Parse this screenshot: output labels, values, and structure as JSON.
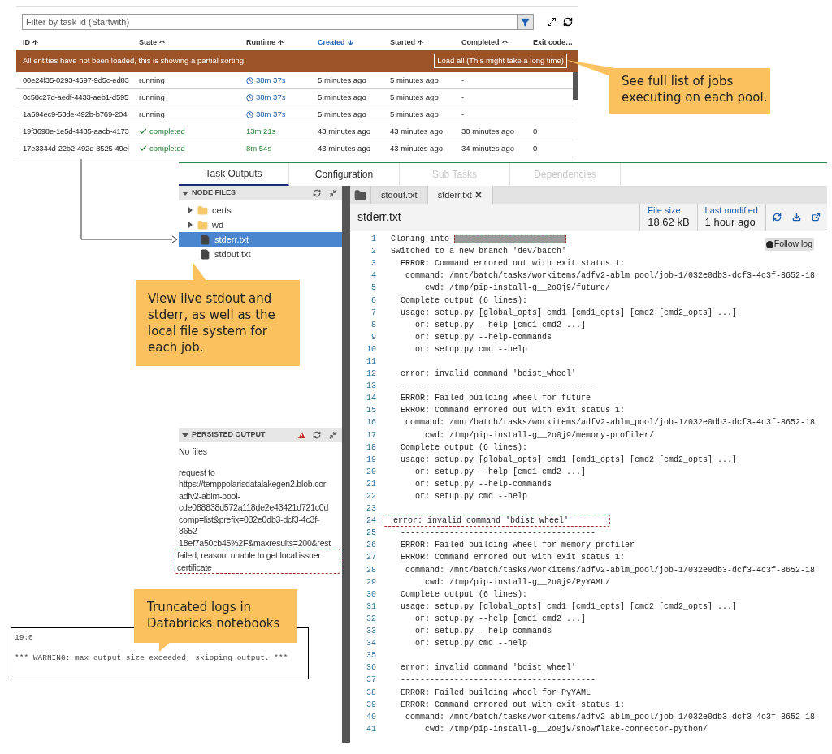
{
  "jobs_table": {
    "filter_placeholder": "Filter by task id (Startwith)",
    "columns": [
      {
        "label": "ID",
        "sortable": true,
        "descending": false,
        "selected": false
      },
      {
        "label": "State",
        "sortable": true,
        "descending": false,
        "selected": false
      },
      {
        "label": "Runtime",
        "sortable": true,
        "descending": false,
        "selected": false
      },
      {
        "label": "Created",
        "sortable": true,
        "descending": true,
        "selected": true
      },
      {
        "label": "Started",
        "sortable": true,
        "descending": false,
        "selected": false
      },
      {
        "label": "Completed",
        "sortable": true,
        "descending": false,
        "selected": false
      },
      {
        "label": "Exit code…",
        "sortable": false,
        "selected": false
      }
    ],
    "banner": {
      "message": "All entities have not been loaded, this is showing a partial sorting.",
      "button": "Load all (This might take a long time)"
    },
    "rows": [
      {
        "id": "00e24f35-0293-4597-9d5c-ed83",
        "completed_state": false,
        "state": "running",
        "runtime": "38m 37s",
        "created": "5 minutes ago",
        "started": "5 minutes ago",
        "completed": "-"
      },
      {
        "id": "0c58c27d-aedf-4433-aeb1-d595",
        "completed_state": false,
        "state": "running",
        "runtime": "38m 37s",
        "created": "5 minutes ago",
        "started": "5 minutes ago",
        "completed": "-"
      },
      {
        "id": "1a594ec9-53de-492b-b769-204:",
        "completed_state": false,
        "state": "running",
        "runtime": "38m 37s",
        "created": "5 minutes ago",
        "started": "5 minutes ago",
        "completed": "-"
      },
      {
        "id": "19f3698e-1e5d-4435-aacb-4173",
        "completed_state": true,
        "state": "completed",
        "runtime": "13m 21s",
        "created": "43 minutes ago",
        "started": "43 minutes ago",
        "completed": "30 minutes ago",
        "exit_code": "0"
      },
      {
        "id": "17e3344d-22b2-492d-8525-49el",
        "completed_state": true,
        "state": "completed",
        "runtime": "8m 54s",
        "created": "43 minutes ago",
        "started": "43 minutes ago",
        "completed": "34 minutes ago",
        "exit_code": "0"
      }
    ]
  },
  "callouts": [
    {
      "text": "See full list of jobs executing on each pool."
    },
    {
      "text": "View live stdout and stderr, as well as the local file system for each job."
    },
    {
      "text": "Truncated logs in Databricks notebooks"
    }
  ],
  "task_panel": {
    "tabs": [
      {
        "label": "Task Outputs",
        "selected": true,
        "disabled": false
      },
      {
        "label": "Configuration",
        "selected": false,
        "disabled": false
      },
      {
        "label": "Sub Tasks",
        "selected": false,
        "disabled": true
      },
      {
        "label": "Dependencies",
        "selected": false,
        "disabled": true
      }
    ],
    "node_files": {
      "title": "NODE FILES",
      "items": [
        {
          "name": "certs",
          "kind": "folder",
          "expanded": false,
          "selected": false
        },
        {
          "name": "wd",
          "kind": "folder",
          "expanded": false,
          "selected": false
        },
        {
          "name": "stderr.txt",
          "kind": "file",
          "selected": true
        },
        {
          "name": "stdout.txt",
          "kind": "file",
          "selected": false
        }
      ]
    },
    "persisted_output": {
      "title": "PERSISTED OUTPUT",
      "status": "No files",
      "lines": [
        "request to",
        "https://temppolarisdatalakegen2.blob.cor",
        "adfv2-ablm-pool-",
        "cde088838d572a118de2e43421d721c0d",
        "comp=list&prefix=032e0db3-dcf3-4c3f-",
        "8652-",
        "18ef7a50cb45%2F&maxresults=200&rest"
      ],
      "highlighted_lines": [
        "failed, reason: unable to get local issuer",
        "certificate"
      ]
    },
    "file_tabs": [
      {
        "label": "stdout.txt",
        "selected": false
      },
      {
        "label": "stderr.txt",
        "selected": true
      }
    ],
    "file": {
      "name": "stderr.txt",
      "size_label": "File size",
      "size": "18.62 kB",
      "modified_label": "Last modified",
      "modified": "1 hour ago"
    },
    "follow_log": "Follow log",
    "lines": [
      {
        "number": "1",
        "kind": "redacted",
        "text": "Cloning into "
      },
      {
        "number": "2",
        "kind": "plain",
        "text": "Switched to a new branch 'dev/batch'"
      },
      {
        "number": "3",
        "kind": "plain",
        "text": "  ERROR: Command errored out with exit status 1:"
      },
      {
        "number": "4",
        "kind": "plain",
        "text": "   command: /mnt/batch/tasks/workitems/adfv2-ablm_pool/job-1/032e0db3-dcf3-4c3f-8652-18"
      },
      {
        "number": "5",
        "kind": "plain",
        "text": "       cwd: /tmp/pip-install-g__2o0j9/future/"
      },
      {
        "number": "6",
        "kind": "plain",
        "text": "  Complete output (6 lines):"
      },
      {
        "number": "7",
        "kind": "plain",
        "text": "  usage: setup.py [global_opts] cmd1 [cmd1_opts] [cmd2 [cmd2_opts] ...]"
      },
      {
        "number": "8",
        "kind": "plain",
        "text": "     or: setup.py --help [cmd1 cmd2 ...]"
      },
      {
        "number": "9",
        "kind": "plain",
        "text": "     or: setup.py --help-commands"
      },
      {
        "number": "10",
        "kind": "plain",
        "text": "     or: setup.py cmd --help"
      },
      {
        "number": "11",
        "kind": "plain"
      },
      {
        "number": "12",
        "kind": "plain",
        "text": "  error: invalid command 'bdist_wheel'"
      },
      {
        "number": "13",
        "kind": "plain",
        "text": "  ----------------------------------------"
      },
      {
        "number": "14",
        "kind": "plain",
        "text": "  ERROR: Failed building wheel for future"
      },
      {
        "number": "15",
        "kind": "plain",
        "text": "  ERROR: Command errored out with exit status 1:"
      },
      {
        "number": "16",
        "kind": "plain",
        "text": "   command: /mnt/batch/tasks/workitems/adfv2-ablm_pool/job-1/032e0db3-dcf3-4c3f-8652-18"
      },
      {
        "number": "17",
        "kind": "plain",
        "text": "       cwd: /tmp/pip-install-g__2o0j9/memory-profiler/"
      },
      {
        "number": "18",
        "kind": "plain",
        "text": "  Complete output (6 lines):"
      },
      {
        "number": "19",
        "kind": "plain",
        "text": "  usage: setup.py [global_opts] cmd1 [cmd1_opts] [cmd2 [cmd2_opts] ...]"
      },
      {
        "number": "20",
        "kind": "plain",
        "text": "     or: setup.py --help [cmd1 cmd2 ...]"
      },
      {
        "number": "21",
        "kind": "plain",
        "text": "     or: setup.py --help-commands"
      },
      {
        "number": "22",
        "kind": "plain",
        "text": "     or: setup.py cmd --help"
      },
      {
        "number": "23",
        "kind": "plain"
      },
      {
        "number": "24",
        "kind": "highlighted",
        "text": "  error: invalid command 'bdist_wheel'"
      },
      {
        "number": "25",
        "kind": "plain",
        "text": "  ----------------------------------------"
      },
      {
        "number": "26",
        "kind": "plain",
        "text": "  ERROR: Failed building wheel for memory-profiler"
      },
      {
        "number": "27",
        "kind": "plain",
        "text": "  ERROR: Command errored out with exit status 1:"
      },
      {
        "number": "28",
        "kind": "plain",
        "text": "   command: /mnt/batch/tasks/workitems/adfv2-ablm_pool/job-1/032e0db3-dcf3-4c3f-8652-18"
      },
      {
        "number": "29",
        "kind": "plain",
        "text": "       cwd: /tmp/pip-install-g__2o0j9/PyYAML/"
      },
      {
        "number": "30",
        "kind": "plain",
        "text": "  Complete output (6 lines):"
      },
      {
        "number": "31",
        "kind": "plain",
        "text": "  usage: setup.py [global_opts] cmd1 [cmd1_opts] [cmd2 [cmd2_opts] ...]"
      },
      {
        "number": "32",
        "kind": "plain",
        "text": "     or: setup.py --help [cmd1 cmd2 ...]"
      },
      {
        "number": "33",
        "kind": "plain",
        "text": "     or: setup.py --help-commands"
      },
      {
        "number": "34",
        "kind": "plain",
        "text": "     or: setup.py cmd --help"
      },
      {
        "number": "35",
        "kind": "plain"
      },
      {
        "number": "36",
        "kind": "plain",
        "text": "  error: invalid command 'bdist_wheel'"
      },
      {
        "number": "37",
        "kind": "plain",
        "text": "  ----------------------------------------"
      },
      {
        "number": "38",
        "kind": "plain",
        "text": "  ERROR: Failed building wheel for PyYAML"
      },
      {
        "number": "39",
        "kind": "plain",
        "text": "  ERROR: Command errored out with exit status 1:"
      },
      {
        "number": "40",
        "kind": "plain",
        "text": "   command: /mnt/batch/tasks/workitems/adfv2-ablm_pool/job-1/032e0db3-dcf3-4c3f-8652-18"
      },
      {
        "number": "41",
        "kind": "plain",
        "text": "       cwd: /tmp/pip-install-g__2o0j9/snowflake-connector-python/"
      }
    ]
  },
  "notebook_output": {
    "lines": [
      "19:0",
      "*** WARNING: max output size exceeded, skipping output. ***"
    ]
  }
}
